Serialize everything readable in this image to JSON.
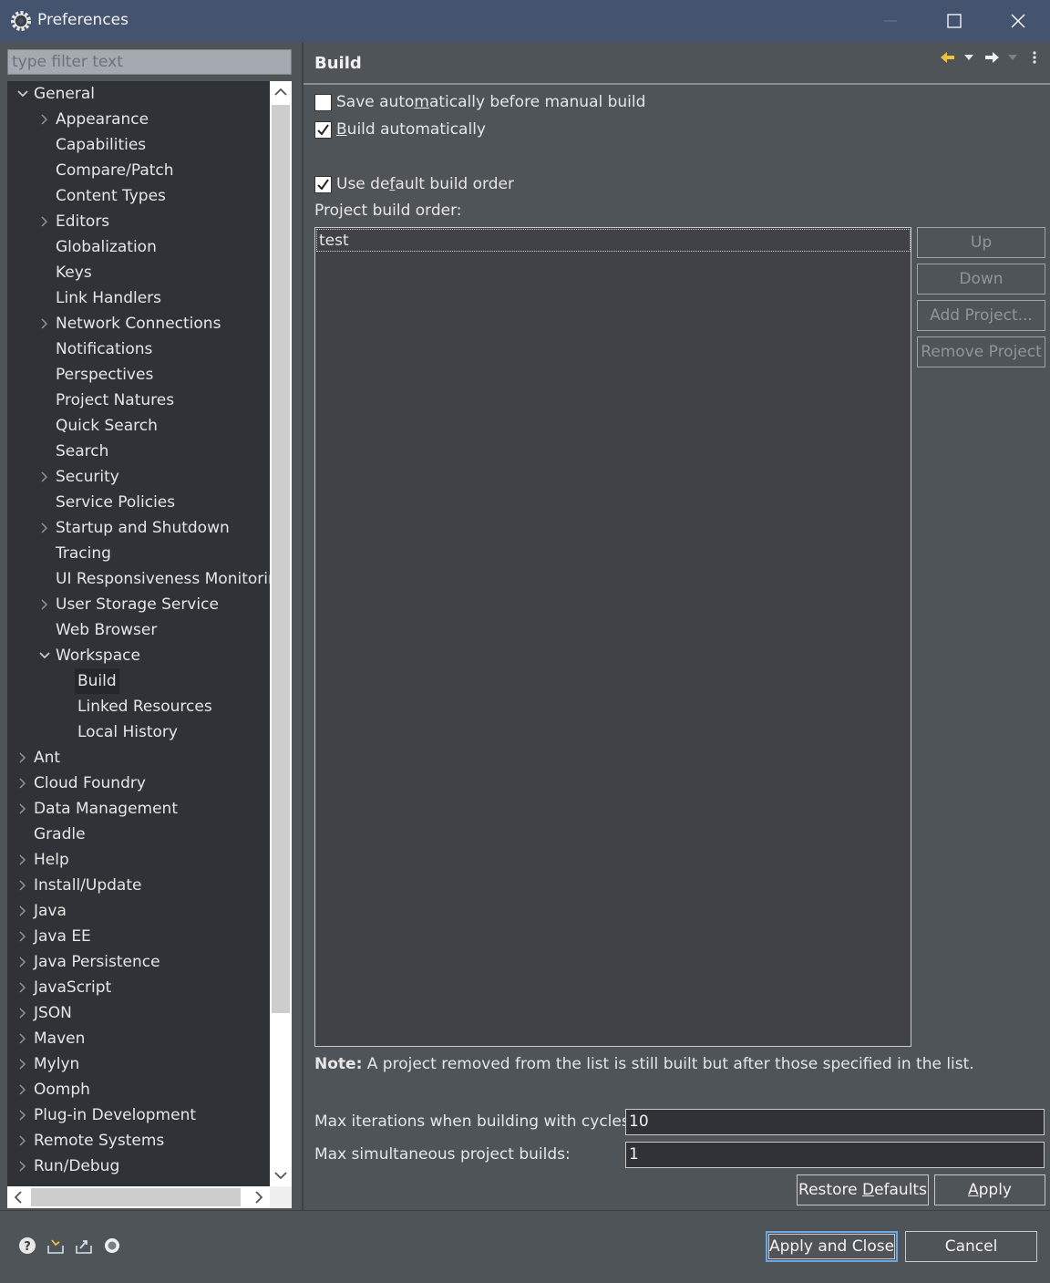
{
  "window": {
    "title": "Preferences",
    "icon": "gear-icon"
  },
  "filter": {
    "placeholder": "type filter text"
  },
  "tree": {
    "items": [
      {
        "label": "General",
        "level": 0,
        "expander": "expanded"
      },
      {
        "label": "Appearance",
        "level": 1,
        "expander": "collapsed"
      },
      {
        "label": "Capabilities",
        "level": 1,
        "expander": "none"
      },
      {
        "label": "Compare/Patch",
        "level": 1,
        "expander": "none"
      },
      {
        "label": "Content Types",
        "level": 1,
        "expander": "none"
      },
      {
        "label": "Editors",
        "level": 1,
        "expander": "collapsed"
      },
      {
        "label": "Globalization",
        "level": 1,
        "expander": "none"
      },
      {
        "label": "Keys",
        "level": 1,
        "expander": "none"
      },
      {
        "label": "Link Handlers",
        "level": 1,
        "expander": "none"
      },
      {
        "label": "Network Connections",
        "level": 1,
        "expander": "collapsed"
      },
      {
        "label": "Notifications",
        "level": 1,
        "expander": "none"
      },
      {
        "label": "Perspectives",
        "level": 1,
        "expander": "none"
      },
      {
        "label": "Project Natures",
        "level": 1,
        "expander": "none"
      },
      {
        "label": "Quick Search",
        "level": 1,
        "expander": "none"
      },
      {
        "label": "Search",
        "level": 1,
        "expander": "none"
      },
      {
        "label": "Security",
        "level": 1,
        "expander": "collapsed"
      },
      {
        "label": "Service Policies",
        "level": 1,
        "expander": "none"
      },
      {
        "label": "Startup and Shutdown",
        "level": 1,
        "expander": "collapsed"
      },
      {
        "label": "Tracing",
        "level": 1,
        "expander": "none"
      },
      {
        "label": "UI Responsiveness Monitoring",
        "level": 1,
        "expander": "none"
      },
      {
        "label": "User Storage Service",
        "level": 1,
        "expander": "collapsed"
      },
      {
        "label": "Web Browser",
        "level": 1,
        "expander": "none"
      },
      {
        "label": "Workspace",
        "level": 1,
        "expander": "expanded"
      },
      {
        "label": "Build",
        "level": 2,
        "expander": "none",
        "selected": true
      },
      {
        "label": "Linked Resources",
        "level": 2,
        "expander": "none"
      },
      {
        "label": "Local History",
        "level": 2,
        "expander": "none"
      },
      {
        "label": "Ant",
        "level": 0,
        "expander": "collapsed"
      },
      {
        "label": "Cloud Foundry",
        "level": 0,
        "expander": "collapsed"
      },
      {
        "label": "Data Management",
        "level": 0,
        "expander": "collapsed"
      },
      {
        "label": "Gradle",
        "level": 0,
        "expander": "none"
      },
      {
        "label": "Help",
        "level": 0,
        "expander": "collapsed"
      },
      {
        "label": "Install/Update",
        "level": 0,
        "expander": "collapsed"
      },
      {
        "label": "Java",
        "level": 0,
        "expander": "collapsed"
      },
      {
        "label": "Java EE",
        "level": 0,
        "expander": "collapsed"
      },
      {
        "label": "Java Persistence",
        "level": 0,
        "expander": "collapsed"
      },
      {
        "label": "JavaScript",
        "level": 0,
        "expander": "collapsed"
      },
      {
        "label": "JSON",
        "level": 0,
        "expander": "collapsed"
      },
      {
        "label": "Maven",
        "level": 0,
        "expander": "collapsed"
      },
      {
        "label": "Mylyn",
        "level": 0,
        "expander": "collapsed"
      },
      {
        "label": "Oomph",
        "level": 0,
        "expander": "collapsed"
      },
      {
        "label": "Plug-in Development",
        "level": 0,
        "expander": "collapsed"
      },
      {
        "label": "Remote Systems",
        "level": 0,
        "expander": "collapsed"
      },
      {
        "label": "Run/Debug",
        "level": 0,
        "expander": "collapsed"
      }
    ]
  },
  "page": {
    "title": "Build",
    "save_auto": {
      "pre": "Save auto",
      "mn": "m",
      "post": "atically before manual build",
      "checked": false
    },
    "build_auto": {
      "pre": "",
      "mn": "B",
      "post": "uild automatically",
      "checked": true
    },
    "default_order": {
      "pre": "Use de",
      "mn": "f",
      "post": "ault build order",
      "checked": true
    },
    "order_label": "Project build order:",
    "order_items": [
      "test"
    ],
    "side_buttons": {
      "up": "Up",
      "down": "Down",
      "add": "Add Project...",
      "remove": "Remove Project"
    },
    "note_bold": "Note:",
    "note_text": " A project removed from the list is still built but after those specified in the list.",
    "max_iter_label": "Max iterations when building with cycles:",
    "max_iter_value": "10",
    "max_builds_label": "Max simultaneous project builds:",
    "max_builds_value": "1",
    "restore": {
      "pre": "Restore ",
      "mn": "D",
      "post": "efaults"
    },
    "apply": {
      "pre": "",
      "mn": "A",
      "post": "pply"
    }
  },
  "footer": {
    "apply_close": "Apply and Close",
    "cancel": "Cancel",
    "icons": [
      "help-icon",
      "import-icon",
      "export-icon",
      "record-icon"
    ]
  },
  "colors": {
    "titlebar": "#44546e",
    "background": "#4f5458",
    "tree_background": "#2f3337",
    "focus_accent": "#6aa6e0"
  }
}
